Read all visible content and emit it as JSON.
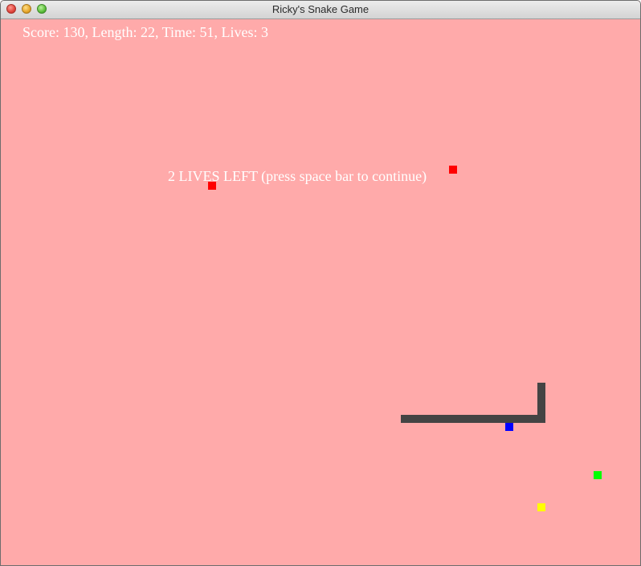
{
  "window": {
    "title": "Ricky's Snake Game"
  },
  "hud": {
    "text": "Score: 130, Length: 22, Time: 51, Lives: 3"
  },
  "message": {
    "text": "2 LIVES LEFT (press space bar to continue)"
  },
  "colors": {
    "background": "#ffaaaa",
    "snake": "#444444",
    "text": "#ffffff",
    "red_item": "#ff0000",
    "blue_item": "#0000ff",
    "green_item": "#00ff00",
    "yellow_item": "#ffff00"
  }
}
